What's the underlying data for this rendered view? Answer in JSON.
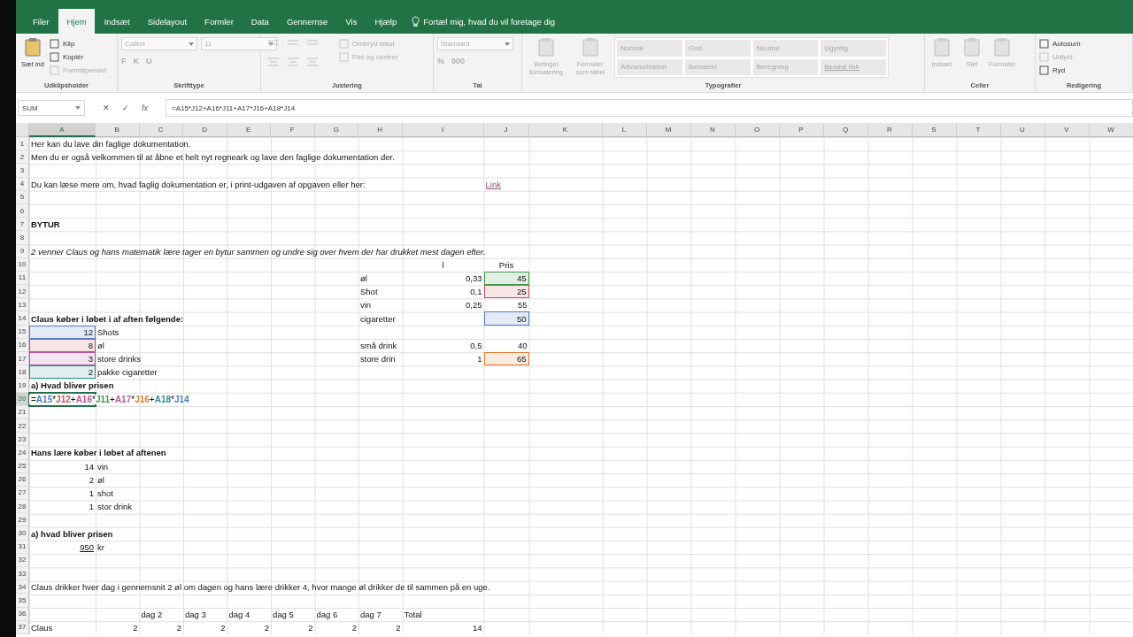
{
  "ribbon": {
    "tabs": [
      {
        "label": "Filer",
        "selected": false
      },
      {
        "label": "Hjem",
        "selected": true
      },
      {
        "label": "Indsæt",
        "selected": false
      },
      {
        "label": "Sidelayout",
        "selected": false
      },
      {
        "label": "Formler",
        "selected": false
      },
      {
        "label": "Data",
        "selected": false
      },
      {
        "label": "Gennemse",
        "selected": false
      },
      {
        "label": "Vis",
        "selected": false
      },
      {
        "label": "Hjælp",
        "selected": false
      }
    ],
    "tell_me": "Fortæl mig, hvad du vil foretage dig",
    "groups": [
      {
        "title": "Udklipsholder",
        "items": [
          {
            "kind": "large",
            "label": "Sæt ind",
            "disabled": false
          },
          {
            "kind": "small",
            "label": "Klip",
            "disabled": false
          },
          {
            "kind": "small",
            "label": "Kopiér",
            "disabled": false
          },
          {
            "kind": "small",
            "label": "Formatpensel",
            "disabled": true
          }
        ]
      },
      {
        "title": "Skrifttype",
        "items": [
          {
            "kind": "dropdown",
            "label": "Calibri",
            "disabled": true
          },
          {
            "kind": "glyphs",
            "glyphs": [
              "F",
              "K",
              "U"
            ],
            "disabled": true
          },
          {
            "kind": "dropdown",
            "label": "11",
            "disabled": true
          }
        ]
      },
      {
        "title": "Justering",
        "items": [
          {
            "kind": "align-icons",
            "disabled": true
          },
          {
            "kind": "small",
            "label": "Ombryd tekst",
            "disabled": true
          },
          {
            "kind": "small",
            "label": "Flet og centrer",
            "disabled": true
          }
        ]
      },
      {
        "title": "Tal",
        "items": [
          {
            "kind": "dropdown",
            "label": "Standard",
            "disabled": true
          },
          {
            "kind": "glyphs",
            "glyphs": [
              "%",
              "000"
            ],
            "disabled": true
          }
        ]
      },
      {
        "title": "Typografier",
        "items": [
          {
            "kind": "large",
            "label": "Betinget formatering",
            "disabled": true
          },
          {
            "kind": "large",
            "label": "Formatér som tabel",
            "disabled": true
          },
          {
            "kind": "gallery",
            "styles": [
              "Normal",
              "God",
              "Neutral",
              "Ugyldig",
              "Advarselstekst",
              "Bemærk!",
              "Beregning",
              "Besøgt link"
            ],
            "disabled": true
          }
        ]
      },
      {
        "title": "Celler",
        "items": [
          {
            "kind": "large",
            "label": "Indsæt",
            "disabled": true
          },
          {
            "kind": "large",
            "label": "Slet",
            "disabled": true
          },
          {
            "kind": "large",
            "label": "Formatér",
            "disabled": true
          }
        ]
      },
      {
        "title": "Redigering",
        "items": [
          {
            "kind": "small",
            "label": "Autosum",
            "disabled": false
          },
          {
            "kind": "small",
            "label": "Udfyld",
            "disabled": true
          },
          {
            "kind": "small",
            "label": "Ryd",
            "disabled": false
          }
        ]
      }
    ]
  },
  "formula_bar": {
    "name_box": "SUM",
    "cancel": "✕",
    "enter": "✓",
    "fx": "fx",
    "formula": "=A15*J12+A16*J11+A17*J16+A18*J14"
  },
  "sheet": {
    "columns": [
      {
        "label": "A",
        "selected": true
      },
      {
        "label": "B",
        "selected": false
      },
      {
        "label": "C",
        "selected": false
      },
      {
        "label": "D",
        "selected": false
      },
      {
        "label": "E",
        "selected": false
      },
      {
        "label": "F",
        "selected": false
      },
      {
        "label": "G",
        "selected": false
      },
      {
        "label": "H",
        "selected": false
      },
      {
        "label": "I",
        "selected": false
      },
      {
        "label": "J",
        "selected": false
      },
      {
        "label": "K",
        "selected": false
      },
      {
        "label": "L",
        "selected": false
      },
      {
        "label": "M",
        "selected": false
      },
      {
        "label": "N",
        "selected": false
      },
      {
        "label": "O",
        "selected": false
      },
      {
        "label": "P",
        "selected": false
      },
      {
        "label": "Q",
        "selected": false
      },
      {
        "label": "R",
        "selected": false
      },
      {
        "label": "S",
        "selected": false
      },
      {
        "label": "T",
        "selected": false
      },
      {
        "label": "U",
        "selected": false
      },
      {
        "label": "V",
        "selected": false
      },
      {
        "label": "W",
        "selected": false
      }
    ],
    "rows": [
      {
        "number": "1",
        "selected": false,
        "cells": {
          "A": {
            "text": "Her kan du lave din faglige dokumentation."
          }
        }
      },
      {
        "number": "2",
        "selected": false,
        "cells": {
          "A": {
            "text": "Men du er også velkommen til at åbne et helt nyt regneark og lave den faglige dokumentation der."
          }
        }
      },
      {
        "number": "3",
        "selected": false,
        "cells": {}
      },
      {
        "number": "4",
        "selected": false,
        "cells": {
          "A": {
            "text": "Du kan læse mere om, hvad faglig dokumentation er, i print-udgaven af opgaven eller her:"
          },
          "J": {
            "text": "Link",
            "link": true
          }
        }
      },
      {
        "number": "5",
        "selected": false,
        "cells": {}
      },
      {
        "number": "6",
        "selected": false,
        "cells": {}
      },
      {
        "number": "7",
        "selected": false,
        "cells": {
          "A": {
            "text": "BYTUR",
            "bold": true
          }
        }
      },
      {
        "number": "8",
        "selected": false,
        "cells": {}
      },
      {
        "number": "9",
        "selected": false,
        "cells": {
          "A": {
            "text": "2 venner Claus og hans matematik lære tager en bytur sammen og undre sig over hvem der har drukket mest dagen efter.",
            "italic": true
          }
        }
      },
      {
        "number": "10",
        "selected": false,
        "cells": {
          "I": {
            "text": "l",
            "centered": true
          },
          "J": {
            "text": "Pris",
            "centered": true
          }
        }
      },
      {
        "number": "11",
        "selected": false,
        "cells": {
          "H": {
            "text": "øl"
          },
          "I": {
            "text": "0,33",
            "align_right": true
          },
          "J": {
            "text": "45",
            "align_right": true,
            "color": "#3c9a4a"
          }
        }
      },
      {
        "number": "12",
        "selected": false,
        "cells": {
          "H": {
            "text": "Shot"
          },
          "I": {
            "text": "0,1",
            "align_right": true
          },
          "J": {
            "text": "25",
            "align_right": true,
            "color": "#d0505a"
          }
        }
      },
      {
        "number": "13",
        "selected": false,
        "cells": {
          "H": {
            "text": "vin"
          },
          "I": {
            "text": "0,25",
            "align_right": true
          },
          "J": {
            "text": "55",
            "align_right": true
          }
        }
      },
      {
        "number": "14",
        "selected": false,
        "cells": {
          "A": {
            "text": "Claus køber i løbet i af aften følgende:",
            "bold": true
          },
          "H": {
            "text": "cigaretter"
          },
          "J": {
            "text": "50",
            "align_right": true,
            "color": "#4a7cc8"
          }
        }
      },
      {
        "number": "15",
        "selected": false,
        "cells": {
          "A": {
            "text": "12",
            "align_right": true,
            "color": "#4a7cc8"
          },
          "B": {
            "text": "Shots"
          }
        }
      },
      {
        "number": "16",
        "selected": false,
        "cells": {
          "A": {
            "text": "8",
            "align_right": true,
            "color": "#d0505a"
          },
          "B": {
            "text": "øl"
          },
          "H": {
            "text": "små drink"
          },
          "I": {
            "text": "0,5",
            "align_right": true
          },
          "J": {
            "text": "40",
            "align_right": true
          }
        }
      },
      {
        "number": "17",
        "selected": false,
        "cells": {
          "A": {
            "text": "3",
            "align_right": true,
            "color": "#b8579e"
          },
          "B": {
            "text": "store drinks"
          },
          "H": {
            "text": "store drin"
          },
          "I": {
            "text": "1",
            "align_right": true
          },
          "J": {
            "text": "65",
            "align_right": true,
            "color": "#e07a30"
          }
        }
      },
      {
        "number": "18",
        "selected": false,
        "cells": {
          "A": {
            "text": "2",
            "align_right": true,
            "color": "#2f8f8a"
          },
          "B": {
            "text": "pakke cigaretter"
          }
        }
      },
      {
        "number": "19",
        "selected": false,
        "cells": {
          "A": {
            "text": "a) Hvad bliver prisen",
            "bold": true
          }
        }
      },
      {
        "number": "20",
        "selected": true,
        "cells": {
          "A": {
            "segments": [
              {
                "text": "="
              },
              {
                "text": "A15",
                "color": "#4a7cc8"
              },
              {
                "text": "*"
              },
              {
                "text": "J12",
                "color": "#d0505a"
              },
              {
                "text": "+"
              },
              {
                "text": "A16",
                "color": "#b8579e"
              },
              {
                "text": "*"
              },
              {
                "text": "J11",
                "color": "#3c9a4a"
              },
              {
                "text": "+"
              },
              {
                "text": "A17",
                "color": "#b8579e"
              },
              {
                "text": "*"
              },
              {
                "text": "J16",
                "color": "#e07a30"
              },
              {
                "text": "+"
              },
              {
                "text": "A18",
                "color": "#2f8f8a"
              },
              {
                "text": "*"
              },
              {
                "text": "J14",
                "color": "#4a7cc8"
              }
            ]
          }
        }
      },
      {
        "number": "21",
        "selected": false,
        "cells": {}
      },
      {
        "number": "22",
        "selected": false,
        "cells": {}
      },
      {
        "number": "23",
        "selected": false,
        "cells": {}
      },
      {
        "number": "24",
        "selected": false,
        "cells": {
          "A": {
            "text": "Hans lære køber i løbet af aftenen",
            "bold": true
          }
        }
      },
      {
        "number": "25",
        "selected": false,
        "cells": {
          "A": {
            "text": "14",
            "align_right": true
          },
          "B": {
            "text": "vin"
          }
        }
      },
      {
        "number": "26",
        "selected": false,
        "cells": {
          "A": {
            "text": "2",
            "align_right": true
          },
          "B": {
            "text": "øl"
          }
        }
      },
      {
        "number": "27",
        "selected": false,
        "cells": {
          "A": {
            "text": "1",
            "align_right": true
          },
          "B": {
            "text": "shot"
          }
        }
      },
      {
        "number": "28",
        "selected": false,
        "cells": {
          "A": {
            "text": "1",
            "align_right": true
          },
          "B": {
            "text": "stor drink"
          }
        }
      },
      {
        "number": "29",
        "selected": false,
        "cells": {}
      },
      {
        "number": "30",
        "selected": false,
        "cells": {
          "A": {
            "text": "a) hvad bliver prisen",
            "bold": true
          }
        }
      },
      {
        "number": "31",
        "selected": false,
        "cells": {
          "A": {
            "text": "950",
            "align_right": true,
            "underline": true
          },
          "B": {
            "text": "kr"
          }
        }
      },
      {
        "number": "32",
        "selected": false,
        "cells": {}
      },
      {
        "number": "33",
        "selected": false,
        "cells": {}
      },
      {
        "number": "34",
        "selected": false,
        "cells": {
          "A": {
            "text": "Claus drikker hver dag i gennemsnit 2 øl om dagen og hans lære drikker 4, hvor mange øl drikker de til sammen på en uge."
          }
        }
      },
      {
        "number": "35",
        "selected": false,
        "cells": {}
      },
      {
        "number": "36",
        "selected": false,
        "cells": {
          "C": {
            "text": "dag 2"
          },
          "D": {
            "text": "dag 3"
          },
          "E": {
            "text": "dag 4"
          },
          "F": {
            "text": "dag 5"
          },
          "G": {
            "text": "dag 6"
          },
          "H": {
            "text": "dag 7"
          },
          "I": {
            "text": "Total"
          }
        }
      },
      {
        "number": "37",
        "selected": false,
        "cells": {
          "A": {
            "text": "Claus"
          },
          "B": {
            "text": "2",
            "align_right": true
          },
          "C": {
            "text": "2",
            "align_right": true
          },
          "D": {
            "text": "2",
            "align_right": true
          },
          "E": {
            "text": "2",
            "align_right": true
          },
          "F": {
            "text": "2",
            "align_right": true
          },
          "G": {
            "text": "2",
            "align_right": true
          },
          "H": {
            "text": "2",
            "align_right": true
          },
          "I": {
            "text": "14",
            "align_right": true
          }
        }
      }
    ]
  }
}
